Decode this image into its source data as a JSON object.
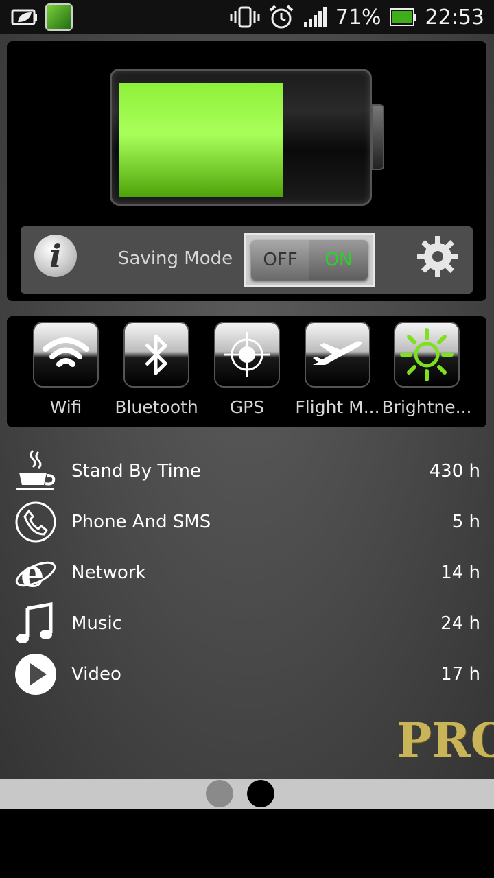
{
  "status_bar": {
    "battery_percent": "71%",
    "time": "22:53",
    "icons": [
      "battery-saver-icon",
      "app-icon",
      "vibrate-icon",
      "alarm-icon",
      "signal-icon",
      "battery-icon"
    ]
  },
  "battery": {
    "level": 0.67,
    "fill_color": "#7ed321"
  },
  "saving_mode": {
    "label": "Saving Mode",
    "toggle_off_label": "OFF",
    "toggle_on_label": "ON"
  },
  "quick_toggles": [
    {
      "label": "Wifi",
      "icon": "wifi-icon"
    },
    {
      "label": "Bluetooth",
      "icon": "bluetooth-icon"
    },
    {
      "label": "GPS",
      "icon": "gps-icon"
    },
    {
      "label": "Flight M...",
      "icon": "airplane-icon"
    },
    {
      "label": "Brightne...",
      "icon": "brightness-icon"
    }
  ],
  "stats": [
    {
      "label": "Stand By Time",
      "value": "430 h",
      "icon": "coffee-cup-icon"
    },
    {
      "label": "Phone And SMS",
      "value": "5 h",
      "icon": "phone-icon"
    },
    {
      "label": "Network",
      "value": "14 h",
      "icon": "browser-icon"
    },
    {
      "label": "Music",
      "value": "24 h",
      "icon": "music-note-icon"
    },
    {
      "label": "Video",
      "value": "17 h",
      "icon": "play-icon"
    }
  ],
  "pro_badge": "PRO",
  "pager": {
    "pages": 2,
    "active": 2
  }
}
